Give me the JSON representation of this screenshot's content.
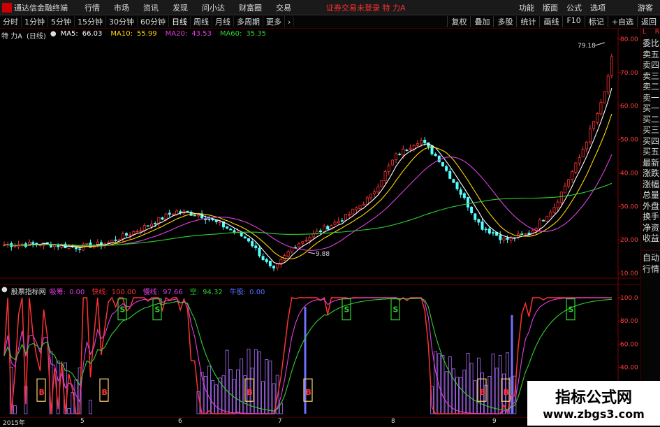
{
  "menubar": {
    "app_title": "通达信金融终端",
    "items": [
      "行情",
      "市场",
      "资讯",
      "发现",
      "问小达",
      "财富圈",
      "交易"
    ],
    "notice": "证券交易未登录 特 力A",
    "right_items": [
      "功能",
      "版面",
      "公式",
      "选项"
    ],
    "user": "游客"
  },
  "toolbar": {
    "periods": [
      "分时",
      "1分钟",
      "5分钟",
      "15分钟",
      "30分钟",
      "60分钟",
      "日线",
      "周线",
      "月线",
      "多周期",
      "更多"
    ],
    "active_period": "日线",
    "right_items": [
      "复权",
      "叠加",
      "多股",
      "统计",
      "画线",
      "F10",
      "标记",
      "+自选",
      "返回"
    ]
  },
  "main_chart": {
    "stock": "特 力A",
    "period_tag": "(日线)",
    "ma": [
      {
        "label": "MA5:",
        "value": "66.03",
        "color": "#ffffff"
      },
      {
        "label": "MA10:",
        "value": "55.99",
        "color": "#ffd700"
      },
      {
        "label": "MA20:",
        "value": "43.53",
        "color": "#e040e0"
      },
      {
        "label": "MA60:",
        "value": "35.35",
        "color": "#30d030"
      }
    ],
    "y_ticks": [
      "80.00",
      "70.00",
      "60.00",
      "50.00",
      "40.00",
      "30.00",
      "20.00",
      "10.00"
    ],
    "max_label": "79.18",
    "min_label": "9.88",
    "colors": {
      "up": "#ff3232",
      "down": "#54ffff",
      "ma5": "#ffffff",
      "ma10": "#ffd700",
      "ma20": "#e040e0",
      "ma60": "#30d030"
    }
  },
  "indicator": {
    "name": "股票指标网",
    "fields": [
      {
        "label": "吸筹:",
        "value": "0.00",
        "color": "#e040e0"
      },
      {
        "label": "快线:",
        "value": "100.00",
        "color": "#ff3232"
      },
      {
        "label": "慢线:",
        "value": "97.66",
        "color": "#e040e0"
      },
      {
        "label": "空:",
        "value": "94.32",
        "color": "#30d030"
      },
      {
        "label": "牛股:",
        "value": "0.00",
        "color": "#5070ff"
      }
    ],
    "y_ticks": [
      "100.0",
      "80.00",
      "60.00",
      "40.00",
      "20.00"
    ],
    "s_label": "S",
    "b_label": "B"
  },
  "date_axis": [
    "2015年",
    "5",
    "6",
    "7",
    "8",
    "9"
  ],
  "sidebar": {
    "top": [
      "L",
      "R"
    ],
    "items": [
      "委比",
      "卖五",
      "卖四",
      "卖三",
      "卖二",
      "卖一",
      "买一",
      "买二",
      "买三",
      "买四",
      "买五",
      "最新",
      "涨跌",
      "涨幅",
      "总量",
      "外盘",
      "换手",
      "净资",
      "收益"
    ],
    "bottom": [
      "自动",
      "行情"
    ]
  },
  "watermark": {
    "title": "指标公式网",
    "url": "www.zbgs3.com"
  }
}
